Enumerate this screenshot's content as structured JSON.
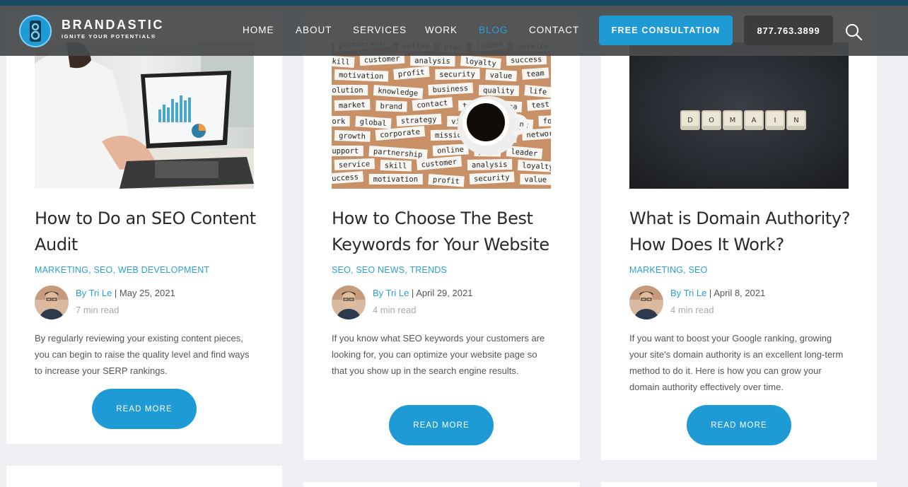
{
  "header": {
    "logo_name": "BRANDASTIC",
    "logo_tagline": "IGNITE YOUR POTENTIAL®",
    "nav": [
      {
        "label": "HOME"
      },
      {
        "label": "ABOUT"
      },
      {
        "label": "SERVICES"
      },
      {
        "label": "WORK"
      },
      {
        "label": "BLOG",
        "active": true
      },
      {
        "label": "CONTACT"
      }
    ],
    "cta_label": "FREE CONSULTATION",
    "phone_label": "877.763.3899",
    "search_icon": "search-icon"
  },
  "colors": {
    "accent": "#1e9bd4",
    "link": "#2a9fd8",
    "header_bg": "#484a4c",
    "page_bg": "#eef0f3"
  },
  "posts": [
    {
      "title": "How to Do an SEO Content Audit",
      "categories": [
        "MARKETING",
        "SEO",
        "WEB DEVELOPMENT"
      ],
      "author_prefix": "By",
      "author": "Tri Le",
      "date": "May 25, 2021",
      "read_time": "7 min read",
      "excerpt": "By regularly reviewing your existing content pieces, you can begin to raise the quality level and find ways to increase your SERP rankings.",
      "button": "READ MORE",
      "image": "laptop-analytics-photo"
    },
    {
      "title": "How to Choose The Best Keywords for Your Website",
      "categories": [
        "SEO",
        "SEO NEWS",
        "TRENDS"
      ],
      "author_prefix": "By",
      "author": "Tri Le",
      "date": "April 29, 2021",
      "read_time": "4 min read",
      "excerpt": "If you know what SEO keywords your customers are looking for, you can optimize your website page so that you show up in the search engine results.",
      "button": "READ MORE",
      "image": "keyword-words-coffee-photo",
      "image_words": [
        "partnership",
        "online",
        "plan",
        "leader",
        "service",
        "skill",
        "customer",
        "analysis",
        "loyalty",
        "success",
        "motivation",
        "profit",
        "security",
        "value",
        "team",
        "solution",
        "knowledge",
        "business",
        "quality",
        "life",
        "market",
        "brand",
        "contact",
        "trade",
        "idea",
        "test",
        "work",
        "global",
        "strategy",
        "vision",
        "training",
        "focus",
        "growth",
        "corporate",
        "mission",
        "inspire",
        "network",
        "support"
      ]
    },
    {
      "title": "What is Domain Authority? How Does It Work?",
      "categories": [
        "MARKETING",
        "SEO"
      ],
      "author_prefix": "By",
      "author": "Tri Le",
      "date": "April 8, 2021",
      "read_time": "4 min read",
      "excerpt": "If you want to boost your Google ranking, growing your site's domain authority is an excellent long-term method to do it. Here is how you can grow your domain authority effectively over time.",
      "button": "READ MORE",
      "image": "domain-keycaps-photo",
      "image_letters": [
        "D",
        "O",
        "M",
        "A",
        "I",
        "N"
      ]
    }
  ]
}
